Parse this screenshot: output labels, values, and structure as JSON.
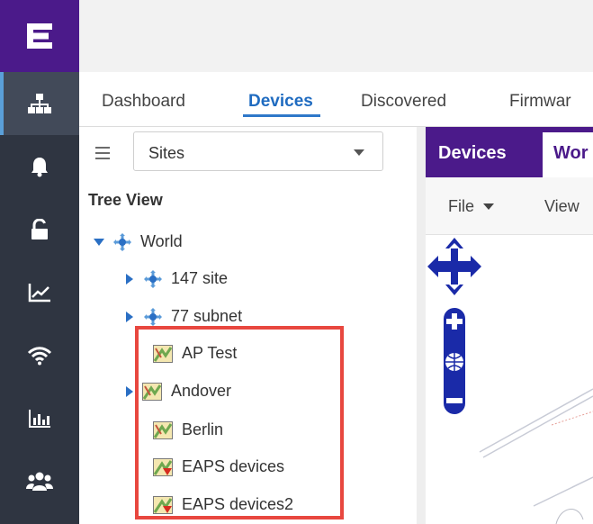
{
  "nav_rail": {
    "items": [
      {
        "icon": "topology-icon",
        "active": true
      },
      {
        "icon": "bell-icon"
      },
      {
        "icon": "unlock-icon"
      },
      {
        "icon": "chart-icon"
      },
      {
        "icon": "wifi-icon"
      },
      {
        "icon": "reports-icon"
      },
      {
        "icon": "users-icon"
      }
    ]
  },
  "tabs": [
    {
      "label": "Dashboard"
    },
    {
      "label": "Devices"
    },
    {
      "label": "Discovered"
    },
    {
      "label": "Firmwar"
    }
  ],
  "left_panel": {
    "select_value": "Sites",
    "tree_title": "Tree View",
    "tree": {
      "root": "World",
      "children": [
        "147 site",
        "77 subnet",
        "AP Test",
        "Andover",
        "Berlin",
        "EAPS devices",
        "EAPS devices2"
      ]
    }
  },
  "right_pane": {
    "tabs": [
      "Devices",
      "Wor"
    ],
    "toolbar": {
      "file": "File",
      "view": "View"
    }
  },
  "colors": {
    "brand_purple": "#4b1a8a",
    "rail": "#2f3541",
    "accent_blue": "#2f78c9",
    "highlight_red": "#e8473f"
  }
}
